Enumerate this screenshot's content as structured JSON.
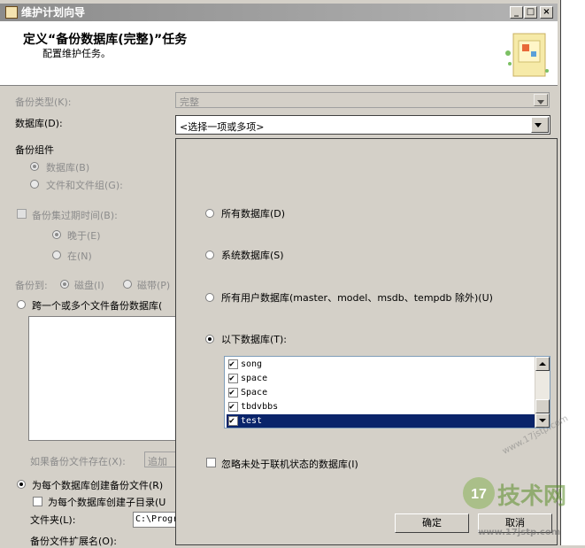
{
  "window": {
    "title": "维护计划向导",
    "buttons": {
      "minimize": "_",
      "maximize": "□",
      "close": "×"
    }
  },
  "header": {
    "title": "定义“备份数据库(完整)”任务",
    "subtitle": "配置维护任务。"
  },
  "form": {
    "backup_type_label": "备份类型(K):",
    "backup_type_value": "完整",
    "database_label": "数据库(D):",
    "database_value": "<选择一项或多项>",
    "backup_component_label": "备份组件",
    "component_database": "数据库(B)",
    "component_files": "文件和文件组(G):",
    "expire_label": "备份集过期时间(B):",
    "expire_after": "晚于(E)",
    "expire_on": "在(N)",
    "backup_to_label": "备份到:",
    "backup_to_disk": "磁盘(I)",
    "backup_to_tape": "磁带(P)",
    "span_files": "跨一个或多个文件备份数据库(",
    "if_exists_label": "如果备份文件存在(X):",
    "if_exists_value": "追加",
    "per_db_file": "为每个数据库创建备份文件(R)",
    "per_db_subdir": "为每个数据库创建子目录(U",
    "folder_label": "文件夹(L):",
    "folder_value": "C:\\Progr",
    "extension_label": "备份文件扩展名(O):"
  },
  "popup": {
    "all_databases": "所有数据库(D)",
    "system_databases": "系统数据库(S)",
    "user_databases": "所有用户数据库(master、model、msdb、tempdb 除外)(U)",
    "these_databases": "以下数据库(T):",
    "databases": [
      {
        "name": "song",
        "checked": true
      },
      {
        "name": "space",
        "checked": true
      },
      {
        "name": "Space",
        "checked": true
      },
      {
        "name": "tbdvbbs",
        "checked": true
      },
      {
        "name": "test",
        "checked": true
      }
    ],
    "ignore_offline": "忽略未处于联机状态的数据库(I)",
    "ok_button": "确定",
    "cancel_button": "取消"
  },
  "watermark": {
    "logo_number": "17",
    "logo_text": "技术网",
    "url_text": "www.17jstp.com",
    "url_short": "www.17jstp.com"
  }
}
